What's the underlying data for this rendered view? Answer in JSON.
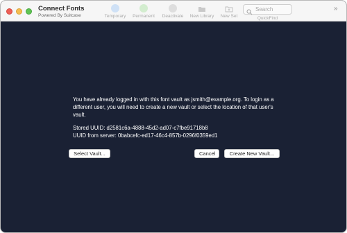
{
  "app": {
    "title": "Connect Fonts",
    "subtitle": "Powered By Suitcase"
  },
  "toolbar": {
    "items": [
      {
        "label": "Temporary",
        "icon": "blue-circle-icon"
      },
      {
        "label": "Permanent",
        "icon": "green-circle-icon"
      },
      {
        "label": "Deactivate",
        "icon": "gray-circle-icon"
      },
      {
        "label": "New Library",
        "icon": "folder-icon"
      },
      {
        "label": "New Set",
        "icon": "new-folder-icon"
      }
    ],
    "search_placeholder": "Search",
    "quickfind_label": "QuickFind",
    "overflow": "»"
  },
  "dialog": {
    "message": "You have already logged in with this font vault as jsmith@example.org. To login as a different user, you will need to create a new vault or select the location of that user's vault.",
    "stored_uuid": "Stored UUID: d2581c6a-4888-45d2-ad07-c7fbe91718b8",
    "server_uuid": "UUID from server: 0babcefc-ed17-46c4-857b-0296f0359ed1",
    "buttons": {
      "select_vault": "Select Vault...",
      "cancel": "Cancel",
      "create_vault": "Create New Vault..."
    }
  },
  "colors": {
    "background": "#1a2134",
    "titlebar": "#f6f6f6"
  }
}
